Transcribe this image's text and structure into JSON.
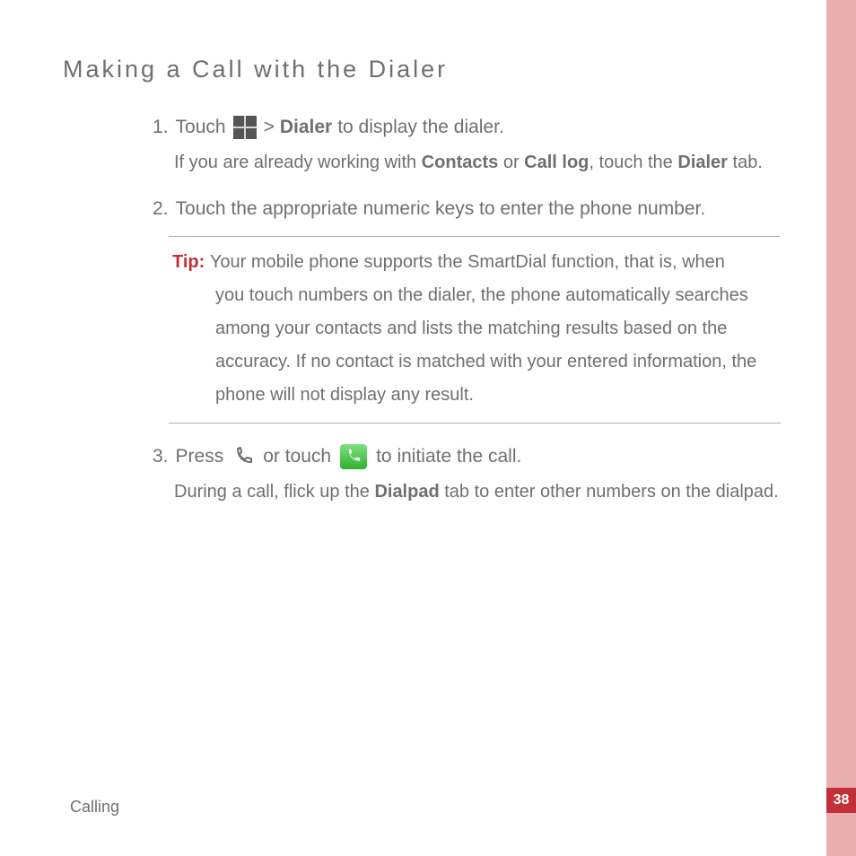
{
  "heading": "Making a Call with the Dialer",
  "steps": {
    "s1": {
      "num": "1.",
      "a": "Touch",
      "gt": ">",
      "dialer": "Dialer",
      "b": "to display the dialer.",
      "sub_a": "If you are already working with ",
      "contacts": "Contacts",
      "or": " or ",
      "calllog": "Call log",
      "sub_b": ", touch the ",
      "sub_c": " tab."
    },
    "s2": {
      "num": "2.",
      "text": "Touch the appropriate numeric keys to enter the phone number."
    },
    "tip": {
      "label": "Tip:  ",
      "first": "Your mobile phone supports the SmartDial function, that is, when",
      "rest": "you touch numbers on the dialer, the phone automatically searches among your contacts and lists the matching results based on the accuracy. If no contact is matched with your entered information, the phone will not display any result."
    },
    "s3": {
      "num": "3.",
      "a": "Press",
      "b": "or touch",
      "c": "to initiate the call.",
      "sub_a": "During a call, flick up the ",
      "dialpad": "Dialpad",
      "sub_b": " tab to enter other numbers on the dialpad."
    }
  },
  "footer": "Calling",
  "page_number": "38"
}
